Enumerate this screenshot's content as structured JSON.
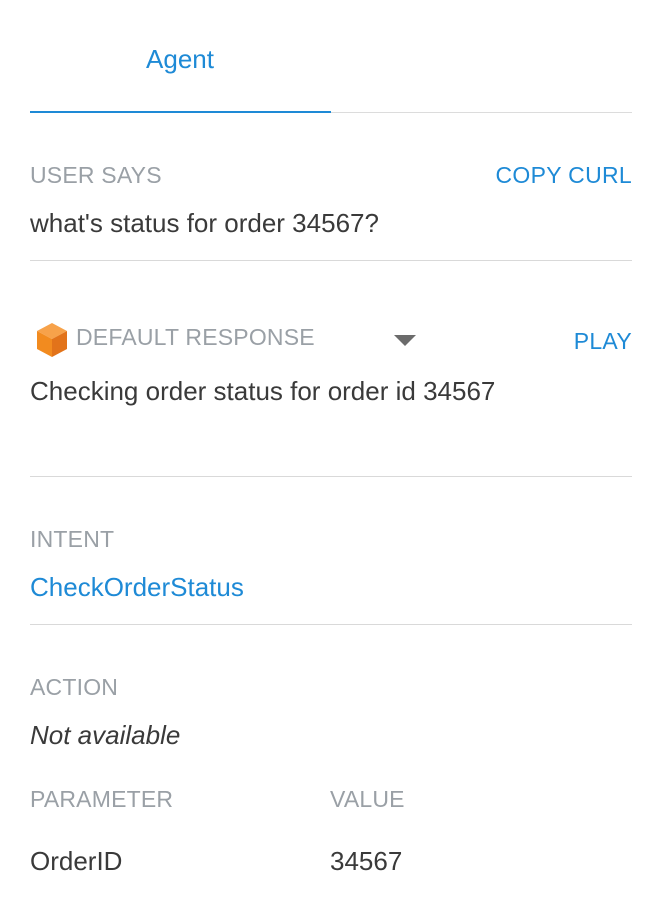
{
  "tabs": [
    {
      "label": "Agent",
      "active": true
    }
  ],
  "user_says": {
    "label": "USER SAYS",
    "copy_curl_label": "COPY CURL",
    "query": "what's status for order 34567?"
  },
  "default_response": {
    "icon": "cube-icon",
    "icon_color": "#f28b1f",
    "label": "DEFAULT RESPONSE",
    "play_label": "PLAY",
    "text": "Checking order status for order id 34567"
  },
  "intent": {
    "label": "INTENT",
    "value": "CheckOrderStatus"
  },
  "action": {
    "label": "ACTION",
    "value": "Not available"
  },
  "parameters": {
    "headers": [
      "PARAMETER",
      "VALUE"
    ],
    "rows": [
      {
        "name": "OrderID",
        "value": "34567"
      }
    ]
  },
  "colors": {
    "accent": "#1e8ad6",
    "muted_label": "#9aa0a6",
    "text": "#3a3a3a",
    "divider": "#d9d9d9"
  }
}
